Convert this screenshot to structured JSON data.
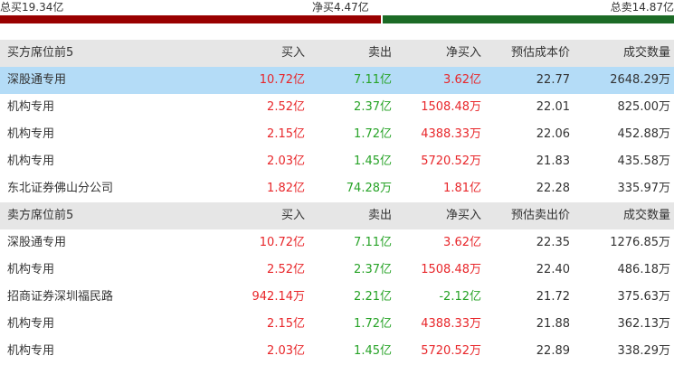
{
  "summary": {
    "total_buy": "总买19.34亿",
    "net_buy": "净买4.47亿",
    "total_sell": "总卖14.87亿",
    "buy_ratio": 0.565,
    "colors": {
      "buy": "#990000",
      "sell": "#1c6b26",
      "up": "#e8262a",
      "down": "#27a327",
      "highlight": "#b4dcf7"
    }
  },
  "buy_section": {
    "headers": [
      "买方席位前5",
      "买入",
      "卖出",
      "净买入",
      "预估成本价",
      "成交数量"
    ],
    "rows": [
      {
        "name": "深股通专用",
        "buy": "10.72亿",
        "sell": "7.11亿",
        "net": "3.62亿",
        "price": "22.77",
        "volume": "2648.29万"
      },
      {
        "name": "机构专用",
        "buy": "2.52亿",
        "sell": "2.37亿",
        "net": "1508.48万",
        "price": "22.01",
        "volume": "825.00万"
      },
      {
        "name": "机构专用",
        "buy": "2.15亿",
        "sell": "1.72亿",
        "net": "4388.33万",
        "price": "22.06",
        "volume": "452.88万"
      },
      {
        "name": "机构专用",
        "buy": "2.03亿",
        "sell": "1.45亿",
        "net": "5720.52万",
        "price": "21.83",
        "volume": "435.58万"
      },
      {
        "name": "东北证券佛山分公司",
        "buy": "1.82亿",
        "sell": "74.28万",
        "net": "1.81亿",
        "price": "22.28",
        "volume": "335.97万"
      }
    ]
  },
  "sell_section": {
    "headers": [
      "卖方席位前5",
      "买入",
      "卖出",
      "净买入",
      "预估卖出价",
      "成交数量"
    ],
    "rows": [
      {
        "name": "深股通专用",
        "buy": "10.72亿",
        "sell": "7.11亿",
        "net": "3.62亿",
        "price": "22.35",
        "volume": "1276.85万"
      },
      {
        "name": "机构专用",
        "buy": "2.52亿",
        "sell": "2.37亿",
        "net": "1508.48万",
        "price": "22.40",
        "volume": "486.18万"
      },
      {
        "name": "招商证券深圳福民路",
        "buy": "942.14万",
        "sell": "2.21亿",
        "net": "-2.12亿",
        "price": "21.72",
        "volume": "375.63万"
      },
      {
        "name": "机构专用",
        "buy": "2.15亿",
        "sell": "1.72亿",
        "net": "4388.33万",
        "price": "21.88",
        "volume": "362.13万"
      },
      {
        "name": "机构专用",
        "buy": "2.03亿",
        "sell": "1.45亿",
        "net": "5720.52万",
        "price": "22.89",
        "volume": "338.29万"
      }
    ]
  }
}
